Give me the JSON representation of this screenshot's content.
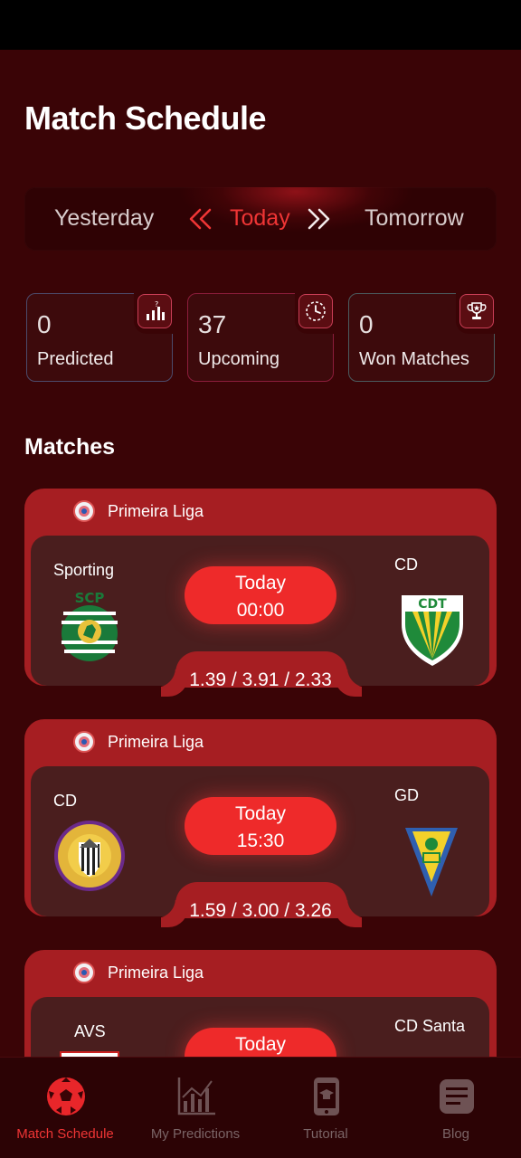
{
  "page": {
    "title": "Match Schedule"
  },
  "day_switch": {
    "yesterday": "Yesterday",
    "today": "Today",
    "tomorrow": "Tomorrow"
  },
  "stats": [
    {
      "value": "0",
      "label": "Predicted",
      "icon": "bar-chart-question-icon"
    },
    {
      "value": "37",
      "label": "Upcoming",
      "icon": "clock-icon"
    },
    {
      "value": "0",
      "label": "Won Matches",
      "icon": "trophy-icon"
    }
  ],
  "matches_title": "Matches",
  "matches": [
    {
      "league": "Primeira Liga",
      "home": "Sporting",
      "away": "CD",
      "day": "Today",
      "time": "00:00",
      "odds": "1.39 / 3.91 / 2.33"
    },
    {
      "league": "Primeira Liga",
      "home": "CD",
      "away": "GD",
      "day": "Today",
      "time": "15:30",
      "odds": "1.59 / 3.00 / 3.26"
    },
    {
      "league": "Primeira Liga",
      "home": "AVS",
      "away": "CD Santa",
      "day": "Today"
    }
  ],
  "nav": [
    {
      "label": "Match Schedule",
      "icon": "soccer-ball-icon",
      "active": true
    },
    {
      "label": "My Predictions",
      "icon": "line-chart-icon",
      "active": false
    },
    {
      "label": "Tutorial",
      "icon": "phone-tutorial-icon",
      "active": false
    },
    {
      "label": "Blog",
      "icon": "blog-icon",
      "active": false
    }
  ],
  "colors": {
    "background": "#3a0406",
    "accent": "#ee2a2a",
    "card": "#a61e22",
    "card_inner": "#4a1e1e"
  }
}
